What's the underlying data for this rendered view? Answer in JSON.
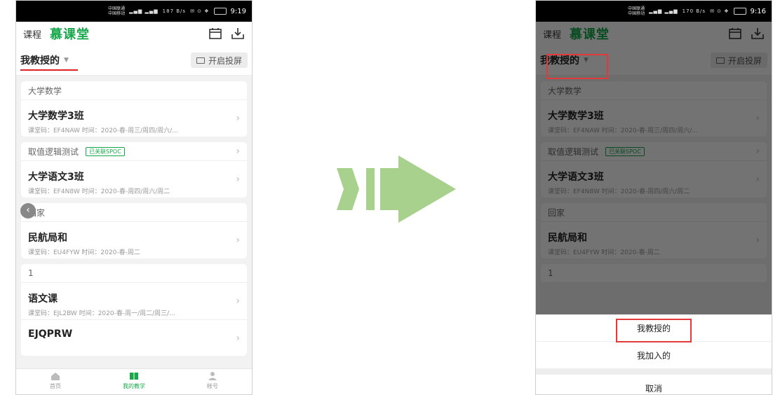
{
  "status": {
    "carrier_top": "中国联通",
    "carrier_bottom": "中国移动",
    "left_time": "9:19",
    "right_time": "9:16",
    "speed_left": "187 B/s",
    "speed_right": "170 B/s"
  },
  "appbar": {
    "course_label": "课程",
    "brand": "慕课堂"
  },
  "filter": {
    "selected": "我教授的",
    "projection_label": "开启投屏"
  },
  "sections": [
    {
      "header": "大学数学",
      "badge": "",
      "course_name": "大学数学3班",
      "course_meta": "课堂码：EF4NAW  时间：2020-春-周三/周四/周六/..."
    },
    {
      "header": "取值逻辑测试",
      "badge": "已关联SPOC",
      "course_name": "大学语文3班",
      "course_meta": "课堂码：EF4N8W  时间：2020-春-周四/周六/周二"
    },
    {
      "header": "回家",
      "badge": "",
      "course_name": "民航局和",
      "course_meta": "课堂码：EU4FYW  时间：2020-春-周二"
    },
    {
      "header": "1",
      "badge": "",
      "course_name": "语文课",
      "course_meta": "课堂码：EJL2BW  时间：2020-春-周一/周二/周三/..."
    },
    {
      "header": "",
      "badge": "",
      "course_name": "EJQPRW",
      "course_meta": ""
    }
  ],
  "bottom_nav": [
    {
      "label": "首页",
      "icon": "home-icon"
    },
    {
      "label": "我的教学",
      "icon": "book-icon"
    },
    {
      "label": "帐号",
      "icon": "user-icon"
    }
  ],
  "sheet": {
    "option_taught": "我教授的",
    "option_joined": "我加入的",
    "cancel": "取消"
  },
  "colors": {
    "brand_green": "#17a84b",
    "highlight_red": "#e23a3a",
    "arrow_green": "#a9d18e"
  }
}
